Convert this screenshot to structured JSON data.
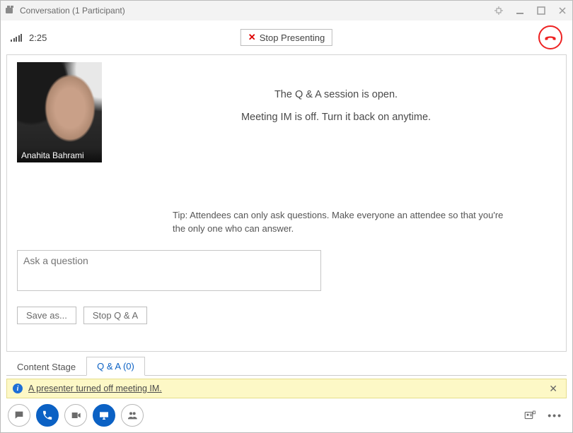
{
  "window": {
    "title": "Conversation (1 Participant)"
  },
  "top": {
    "duration": "2:25",
    "stop_presenting_label": "Stop Presenting"
  },
  "presenter": {
    "name": "Anahita Bahrami"
  },
  "qa": {
    "open_msg": "The Q & A session is open.",
    "im_off_msg": "Meeting IM is off. Turn it back on anytime.",
    "tip": "Tip: Attendees can only ask questions. Make everyone an attendee so that you're the only one who can answer.",
    "ask_placeholder": "Ask a question",
    "save_as_label": "Save as...",
    "stop_qa_label": "Stop Q & A"
  },
  "tabs": {
    "content_stage": "Content Stage",
    "qa_tab": "Q & A (0)"
  },
  "notice": {
    "text": "A presenter turned off meeting IM."
  }
}
